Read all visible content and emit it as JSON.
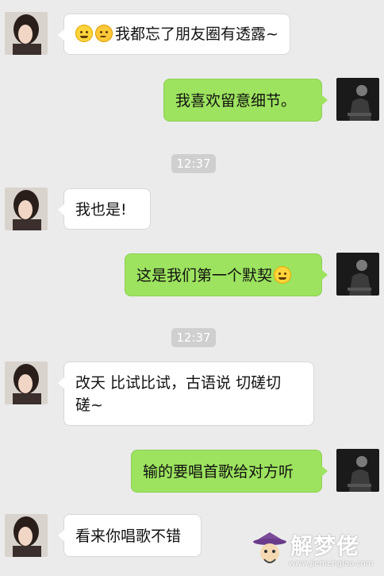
{
  "messages": [
    {
      "side": "in",
      "emojis": [
        "smiling-face",
        "thinking-face"
      ],
      "text": "我都忘了朋友圈有透露~"
    },
    {
      "side": "out",
      "text": "我喜欢留意细节。"
    },
    {
      "type": "time",
      "text": "12:37"
    },
    {
      "side": "in",
      "text": "我也是!"
    },
    {
      "side": "out",
      "text": "这是我们第一个默契",
      "emojis": [
        "smiling-face"
      ]
    },
    {
      "type": "time",
      "text": "12:37"
    },
    {
      "side": "in",
      "text_lines": [
        "改天 比试比试，古语说 切磋切",
        "磋~"
      ]
    },
    {
      "side": "out",
      "text": "输的要唱首歌给对方听"
    },
    {
      "side": "in",
      "text": "看来你唱歌不错"
    }
  ],
  "watermark": {
    "brand": "解梦佬",
    "url": "www.jiemenglao.com"
  }
}
